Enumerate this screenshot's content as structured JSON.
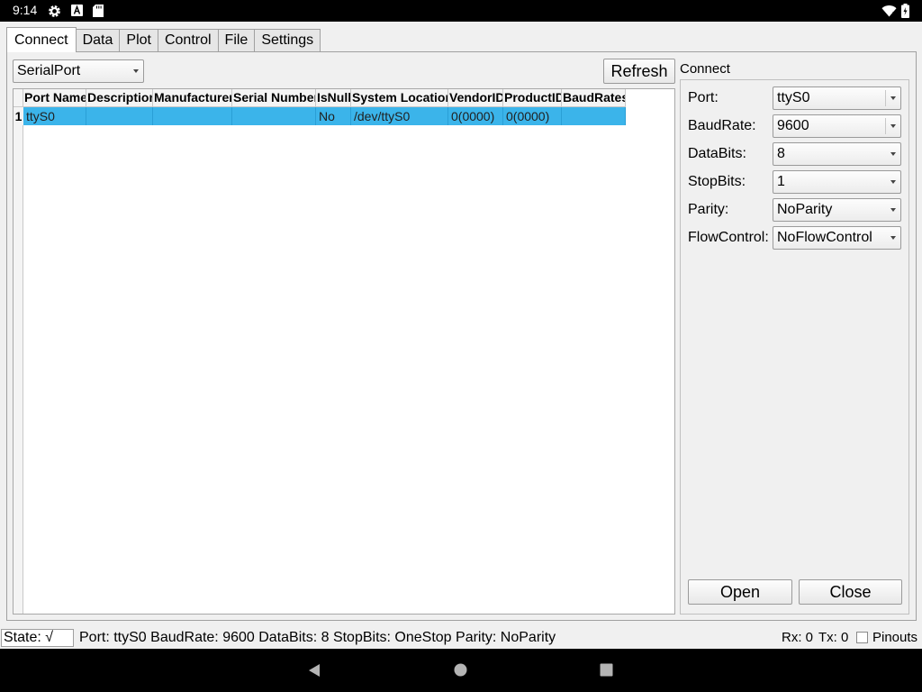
{
  "status_bar": {
    "time": "9:14",
    "icons": [
      "gear-icon",
      "a-notification-icon",
      "sd-card-icon",
      "wifi-icon",
      "battery-icon"
    ]
  },
  "tabs": [
    {
      "label": "Connect",
      "active": true
    },
    {
      "label": "Data"
    },
    {
      "label": "Plot"
    },
    {
      "label": "Control"
    },
    {
      "label": "File"
    },
    {
      "label": "Settings"
    }
  ],
  "connect": {
    "port_type": "SerialPort",
    "refresh_label": "Refresh",
    "table": {
      "headers": [
        "Port Name",
        "Description",
        "Manufacturer",
        "Serial Number",
        "IsNull",
        "System Location",
        "VendorID",
        "ProductID",
        "BaudRates"
      ],
      "rows": [
        {
          "index": "1",
          "cells": [
            "ttyS0",
            "",
            "",
            "",
            "No",
            "/dev/ttyS0",
            "0(0000)",
            "0(0000)",
            ""
          ]
        }
      ]
    },
    "group_title": "Connect",
    "settings": {
      "port": {
        "label": "Port:",
        "value": "ttyS0"
      },
      "baudrate": {
        "label": "BaudRate:",
        "value": "9600"
      },
      "databits": {
        "label": "DataBits:",
        "value": "8"
      },
      "stopbits": {
        "label": "StopBits:",
        "value": "1"
      },
      "parity": {
        "label": "Parity:",
        "value": "NoParity"
      },
      "flowcontrol": {
        "label": "FlowControl:",
        "value": "NoFlowControl"
      }
    },
    "open_label": "Open",
    "close_label": "Close"
  },
  "bottom": {
    "state": "State: √",
    "info": "Port: ttyS0 BaudRate: 9600 DataBits: 8 StopBits: OneStop Parity: NoParity",
    "rx": "Rx: 0",
    "tx": "Tx: 0",
    "pinouts": "Pinouts"
  },
  "colors": {
    "selection": "#3bb4ea",
    "system_bar": "#000000"
  }
}
